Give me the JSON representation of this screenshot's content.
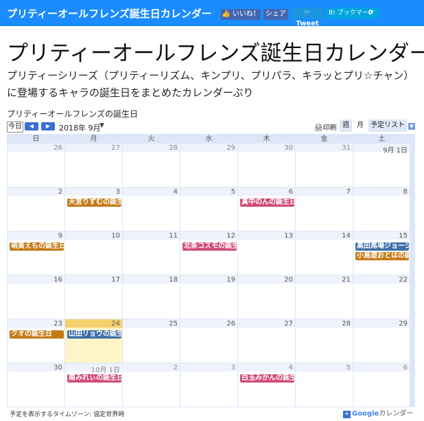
{
  "site": {
    "name": "プリティーオールフレンズ誕生日カレンダー",
    "like_label": "いいね！",
    "share_label": "シェア",
    "tweet_label": "Tweet",
    "hatena_label": "B! ブックマーク",
    "hatena_count": "0"
  },
  "page": {
    "title": "プリティーオールフレンズ誕生日カレンダー",
    "description": "プリティーシリーズ（プリティーリズム、キンプリ、プリパラ、キラッとプリ☆チャン）に登場するキャラの誕生日をまとめたカレンダーぷり"
  },
  "calendar": {
    "title": "プリティーオールフレンズの誕生日",
    "today_label": "今日",
    "prev_icon": "◀",
    "next_icon": "▶",
    "month_label": "2018年 9月",
    "print_label": "印刷",
    "views": [
      "週",
      "月",
      "予定リスト"
    ],
    "weekdays": [
      "日",
      "月",
      "火",
      "水",
      "木",
      "金",
      "土"
    ],
    "weeks": [
      [
        "26",
        "27",
        "28",
        "29",
        "30",
        "31",
        "9月 1日"
      ],
      [
        "2",
        "3",
        "4",
        "5",
        "6",
        "7",
        "8"
      ],
      [
        "9",
        "10",
        "11",
        "12",
        "13",
        "14",
        "15"
      ],
      [
        "16",
        "17",
        "18",
        "19",
        "20",
        "21",
        "22"
      ],
      [
        "23",
        "24",
        "25",
        "26",
        "27",
        "28",
        "29"
      ],
      [
        "30",
        "10月 1日",
        "2",
        "3",
        "4",
        "5",
        "6"
      ]
    ],
    "events": [
      {
        "week": 1,
        "day": 1,
        "row": 0,
        "title": "天宮りずむの誕生日",
        "color": "#c47a16"
      },
      {
        "week": 1,
        "day": 4,
        "row": 0,
        "title": "真中のんの誕生日",
        "color": "#d04a7a"
      },
      {
        "week": 2,
        "day": 0,
        "row": 0,
        "title": "萌黄えもの誕生日",
        "color": "#c47a16"
      },
      {
        "week": 2,
        "day": 3,
        "row": 0,
        "title": "北条コスモの誕生日",
        "color": "#d04a7a"
      },
      {
        "week": 2,
        "day": 6,
        "row": 0,
        "title": "高田馬場ジョージの誕生日",
        "color": "#3f6ea8"
      },
      {
        "week": 2,
        "day": 6,
        "row": 1,
        "title": "小鳥遊おとはの誕生日",
        "color": "#c47a16"
      },
      {
        "week": 4,
        "day": 0,
        "row": 0,
        "title": "クオの誕生日",
        "color": "#c47a16"
      },
      {
        "week": 4,
        "day": 1,
        "row": 0,
        "title": "山田リョウの誕生日",
        "color": "#3f6ea8"
      },
      {
        "week": 5,
        "day": 1,
        "row": 0,
        "title": "南みれぃの誕生日",
        "color": "#d04a7a"
      },
      {
        "week": 5,
        "day": 4,
        "row": 0,
        "title": "白玉みかんの誕生日",
        "color": "#d04a7a"
      }
    ],
    "today": {
      "week": 4,
      "day": 1
    },
    "timezone_label": "予定を表示するタイムゾーン: 協定世界時",
    "gcal_label": "カレンダー",
    "google_label": "Google"
  }
}
